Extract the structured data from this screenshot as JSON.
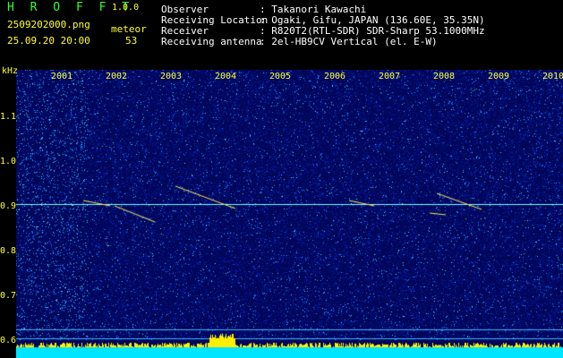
{
  "header": {
    "app_name": "H R O F F T",
    "version": "1.0.0",
    "filename": "2509202000.png",
    "datetime": "25.09.20 20:00",
    "meteor_label": "meteor",
    "meteor_count": "53"
  },
  "info": {
    "observer_label": "Observer",
    "observer_value": ": Takanori Kawachi",
    "location_label": "Receiving Location",
    "location_value": ": Ogaki, Gifu, JAPAN (136.60E, 35.35N)",
    "receiver_label": "Receiver",
    "receiver_value": ": R820T2(RTL-SDR) SDR-Sharp 53.1000MHz",
    "antenna_label": "Receiving antenna",
    "antenna_value": ": 2el-HB9CV Vertical (el. E-W)"
  },
  "axes": {
    "y_unit": "kHz",
    "y_ticks": [
      "1.1",
      "1.0",
      "0.9",
      "0.8",
      "0.7",
      "0.6"
    ],
    "x_ticks": [
      "2001",
      "2002",
      "2003",
      "2004",
      "2005",
      "2006",
      "2007",
      "2008",
      "2009",
      "2010"
    ]
  },
  "colors": {
    "background": "#000000",
    "noise_low": "#000a6e",
    "noise_high": "#2bd3ff",
    "carrier": "#7fffff",
    "meteor_echo": "#ffe14d",
    "baseline": "#00e5ff",
    "header_yellow": "#ffff33",
    "header_green": "#33ff33"
  }
}
